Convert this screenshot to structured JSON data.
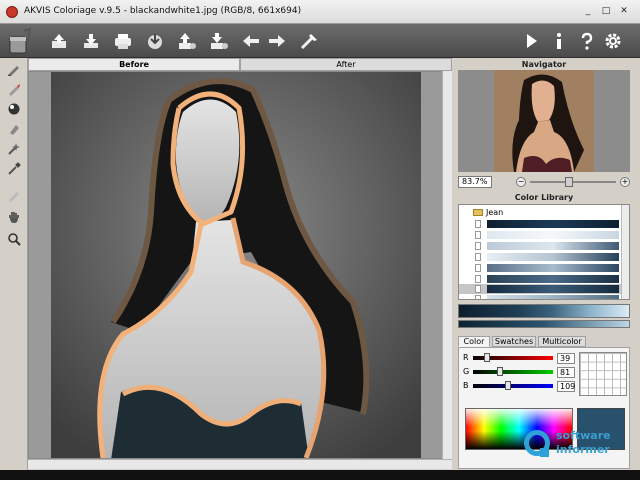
{
  "window": {
    "title": "AKVIS Coloriage v.9.5 - blackandwhite1.jpg (RGB/8, 661x694)",
    "minimize": "_",
    "maximize": "□",
    "close": "✕"
  },
  "toolbar": {
    "left_icons": [
      "paint-bucket-icon",
      "open-icon",
      "save-icon",
      "print-icon",
      "load-strokes-icon",
      "save-strokes-icon",
      "batch-icon",
      "undo-icon",
      "redo-icon",
      "magic-brush-icon"
    ],
    "right_icons": [
      "run-icon",
      "info-icon",
      "help-icon",
      "settings-icon"
    ]
  },
  "tools": [
    "pencil-icon",
    "keep-color-pencil-icon",
    "color-ball-icon",
    "eraser-icon",
    "magic-tube-icon",
    "eyedropper-icon",
    "chalk-icon",
    "hand-icon",
    "zoom-icon"
  ],
  "canvas": {
    "tab_before": "Before",
    "tab_after": "After"
  },
  "navigator": {
    "title": "Navigator",
    "zoom": "83.7%",
    "zoom_level": 0.45,
    "minus": "−",
    "plus": "+"
  },
  "library": {
    "title": "Color Library",
    "folder": "Jean"
  },
  "color_panel": {
    "tabs": [
      "Color",
      "Swatches",
      "Multicolor"
    ],
    "r_label": "R",
    "g_label": "G",
    "b_label": "B",
    "r": "39",
    "g": "81",
    "b": "109",
    "current_color": "#27516d"
  },
  "watermark": {
    "line1": "software",
    "line2": "informer"
  }
}
